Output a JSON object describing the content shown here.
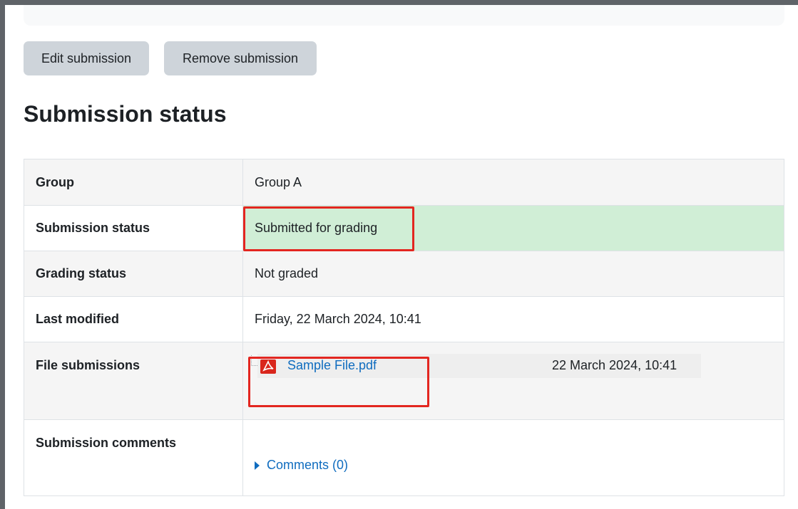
{
  "actions": {
    "edit_label": "Edit submission",
    "remove_label": "Remove submission"
  },
  "page_title": "Submission status",
  "rows": {
    "group": {
      "label": "Group",
      "value": "Group A"
    },
    "submission_status": {
      "label": "Submission status",
      "value": "Submitted for grading"
    },
    "grading_status": {
      "label": "Grading status",
      "value": "Not graded"
    },
    "last_modified": {
      "label": "Last modified",
      "value": "Friday, 22 March 2024, 10:41"
    },
    "file_submissions": {
      "label": "File submissions",
      "file_name": "Sample File.pdf",
      "file_date": "22 March 2024, 10:41",
      "icon": "pdf-icon"
    },
    "submission_comments": {
      "label": "Submission comments",
      "toggle": "Comments (0)",
      "icon": "triangle-right-icon"
    }
  },
  "colors": {
    "accent_link": "#0f6cbf",
    "success_bg": "#d0eed6",
    "highlight": "#e32620",
    "button_bg": "#ced4da"
  }
}
